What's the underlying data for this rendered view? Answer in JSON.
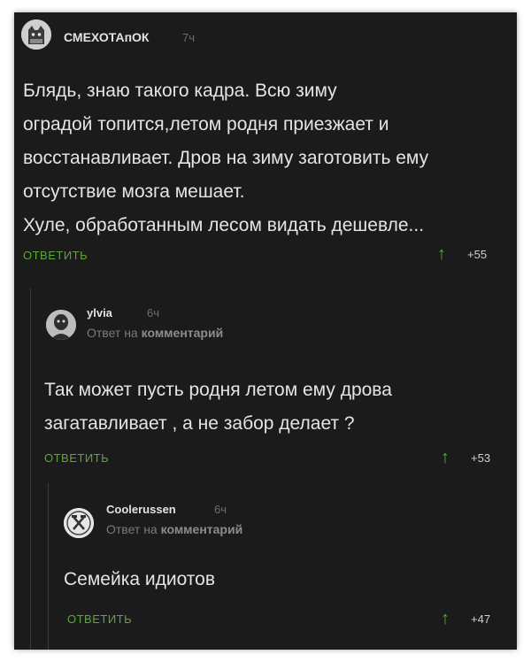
{
  "comments": [
    {
      "username": "СМЕХОТАпОК",
      "time": "7ч",
      "body": [
        "Блядь, знаю такого кадра. Всю зиму",
        "оградой топится,летом родня приезжает и",
        "восстанавливает. Дров на зиму заготовить ему",
        "отсутствие мозга мешает.",
        "Хуле, обработанным лесом видать дешевле..."
      ],
      "reply_label": "ОТВЕТИТЬ",
      "score": "+55"
    },
    {
      "username": "ylvia",
      "time": "6ч",
      "reply_prefix": "Ответ на",
      "reply_target": "комментарий",
      "body": [
        "Так может пусть родня летом ему дрова",
        "загатавливает , а не забор делает ?"
      ],
      "reply_label": "ОТВЕТИТЬ",
      "score": "+53"
    },
    {
      "username": "Coolerussen",
      "time": "6ч",
      "reply_prefix": "Ответ на",
      "reply_target": "комментарий",
      "body": [
        "Семейка идиотов"
      ],
      "reply_label": "ОТВЕТИТЬ",
      "score": "+47"
    }
  ],
  "icons": {
    "upvote": "up-arrow-icon"
  },
  "colors": {
    "background": "#1b1b1b",
    "accent": "#5aa838",
    "text": "#e4e4e4"
  }
}
